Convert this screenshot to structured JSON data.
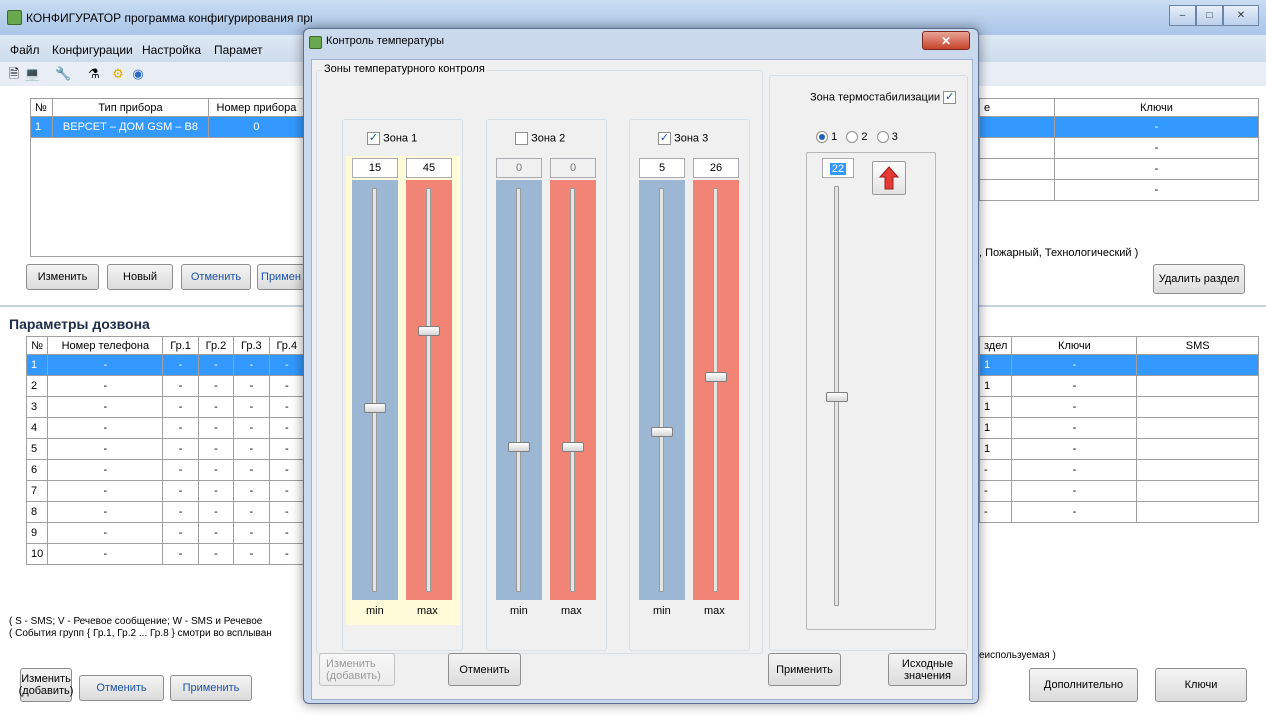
{
  "main_window": {
    "title": "КОНФИГУРАТОР программа конфигурирования прибора «ВЕРСЕТ – ДОМ»",
    "menu": [
      "Файл",
      "Конфигурации",
      "Настройка",
      "Парамет"
    ],
    "devices_table": {
      "headers": [
        "№",
        "Тип прибора",
        "Номер прибора"
      ],
      "rows": [
        [
          "1",
          "ВЕРСЕТ – ДОМ GSM – В8",
          "0"
        ]
      ]
    },
    "right_table_top": {
      "headers": [
        "е",
        "Ключи"
      ],
      "rows": [
        [
          "",
          "-"
        ],
        [
          "",
          "-"
        ],
        [
          "",
          "-"
        ],
        [
          "",
          "-"
        ]
      ]
    },
    "section_note": ", Пожарный, Технологический )",
    "top_buttons": {
      "edit": "Изменить",
      "new": "Новый",
      "cancel": "Отменить",
      "apply": "Примен",
      "delete_section": "Удалить раздел"
    },
    "dial_group_title": "Параметры дозвона",
    "dial_table": {
      "headers": [
        "№",
        "Номер телефона",
        "Гр.1",
        "Гр.2",
        "Гр.3",
        "Гр.4"
      ],
      "rows": [
        [
          "1",
          "-",
          "-",
          "-",
          "-",
          "-"
        ],
        [
          "2",
          "-",
          "-",
          "-",
          "-",
          "-"
        ],
        [
          "3",
          "-",
          "-",
          "-",
          "-",
          "-"
        ],
        [
          "4",
          "-",
          "-",
          "-",
          "-",
          "-"
        ],
        [
          "5",
          "-",
          "-",
          "-",
          "-",
          "-"
        ],
        [
          "6",
          "-",
          "-",
          "-",
          "-",
          "-"
        ],
        [
          "7",
          "-",
          "-",
          "-",
          "-",
          "-"
        ],
        [
          "8",
          "-",
          "-",
          "-",
          "-",
          "-"
        ],
        [
          "9",
          "-",
          "-",
          "-",
          "-",
          "-"
        ],
        [
          "10",
          "-",
          "-",
          "-",
          "-",
          "-"
        ]
      ]
    },
    "right_table_bottom": {
      "headers": [
        "здел",
        "Ключи",
        "SMS"
      ],
      "rows": [
        [
          "1",
          "-",
          ""
        ],
        [
          "1",
          "-",
          ""
        ],
        [
          "1",
          "-",
          ""
        ],
        [
          "1",
          "-",
          ""
        ],
        [
          "1",
          "-",
          ""
        ],
        [
          "-",
          "-",
          ""
        ],
        [
          "-",
          "-",
          ""
        ],
        [
          "-",
          "-",
          ""
        ]
      ]
    },
    "legend_line1": "( S - SMS;  V - Речевое сообщение;  W - SMS и Речевое",
    "legend_line2": "( События групп { Гр.1, Гр.2 ... Гр.8 } смотри во всплыван",
    "unused_note": "еиспользуемая )",
    "bottom_buttons": {
      "edit_add": "Изменить\n(добавить)",
      "cancel": "Отменить",
      "apply": "Применить",
      "extra": "Дополнительно",
      "keys": "Ключи"
    }
  },
  "dialog": {
    "title": "Контроль температуры",
    "zones_group_title": "Зоны температурного контроля",
    "zones": [
      {
        "label": "Зона 1",
        "checked": true,
        "min": "15",
        "max": "45",
        "min_label": "min",
        "max_label": "max",
        "enabled": true
      },
      {
        "label": "Зона 2",
        "checked": false,
        "min": "0",
        "max": "0",
        "min_label": "min",
        "max_label": "max",
        "enabled": false
      },
      {
        "label": "Зона 3",
        "checked": true,
        "min": "5",
        "max": "26",
        "min_label": "min",
        "max_label": "max",
        "enabled": true
      }
    ],
    "thermo": {
      "label": "Зона термостабилизации",
      "checked": true,
      "radios": [
        "1",
        "2",
        "3"
      ],
      "selected_radio": "1",
      "value": "22"
    },
    "buttons": {
      "edit_add": "Изменить\n(добавить)",
      "cancel": "Отменить",
      "apply": "Применить",
      "defaults": "Исходные\nзначения"
    }
  },
  "colors": {
    "min_track": "#9bb7d3",
    "max_track": "#f18474",
    "selection": "#3399ff",
    "arrow": "#e53935"
  }
}
